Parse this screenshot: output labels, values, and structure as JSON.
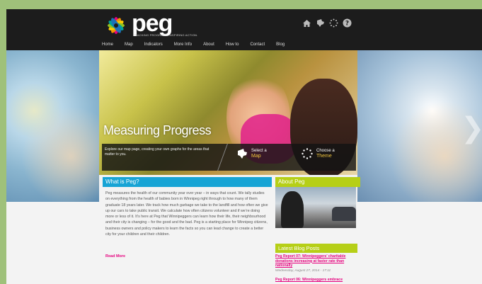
{
  "brand": {
    "name": "peg",
    "tagline": "TRACKING PROGRESS. INSPIRING ACTION."
  },
  "nav": {
    "items": [
      "Home",
      "Map",
      "Indicators",
      "More Info",
      "About",
      "How to",
      "Contact",
      "Blog"
    ],
    "active": "Home"
  },
  "top_icons": [
    "home-icon",
    "manitoba-icon",
    "sunburst-icon",
    "help-icon"
  ],
  "hero": {
    "title": "Measuring Progress",
    "description": "Explore our map page, creating your own graphs for the areas that matter to you.",
    "cta_map": {
      "line1": "Select a",
      "line2": "Map"
    },
    "cta_theme": {
      "line1": "Choose a",
      "line2": "Theme"
    }
  },
  "what_is": {
    "title": "What is Peg?",
    "body": "Peg measures the health of our community year over year – in ways that count. We tally studies on everything from the health of babies born in Winnipeg right through to how many of them graduate 18 years later. We track how much garbage we take to the landfill and how often we give up our cars to take public transit. We calculate how often citizens volunteer and if we’re doing more or less of it. It’s here at Peg that Winnipeggers can learn how their life, their neighbourhood and their city is changing – for the good and the bad. Peg is a starting place for Winnipeg citizens, business owners and policy makers to learn the facts so you can lead change to create a better city for your children and their children.",
    "read_more": "Read More"
  },
  "about": {
    "title": "About Peg"
  },
  "blog": {
    "title": "Latest Blog Posts",
    "posts": [
      {
        "title": "Peg Report 07: Winnipeggers’ charitable donations increasing at faster rate than nationally",
        "date": "Wednesday, August 27, 2014 - 17:11"
      },
      {
        "title": "Peg Report 06: Winnipeggers embrace",
        "date": ""
      }
    ]
  },
  "colors": {
    "accent_pink": "#e6007e",
    "blue": "#17a4d5",
    "green": "#b6cf17",
    "gold": "#f0c53e"
  }
}
